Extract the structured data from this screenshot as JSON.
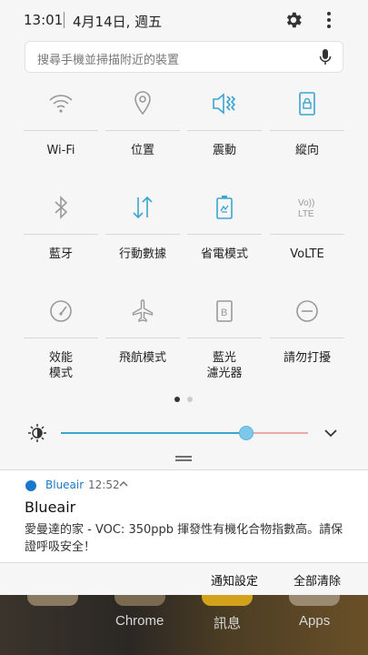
{
  "status_bar": {
    "time": "13:01",
    "date": "4月14日, 週五"
  },
  "search": {
    "placeholder": "搜尋手機並掃描附近的裝置"
  },
  "accent": "#3aa5cf",
  "tiles": [
    {
      "label": "Wi-Fi",
      "icon": "wifi-icon",
      "active": false
    },
    {
      "label": "位置",
      "icon": "location-icon",
      "active": false
    },
    {
      "label": "震動",
      "icon": "vibrate-icon",
      "active": true
    },
    {
      "label": "縱向",
      "icon": "portrait-lock-icon",
      "active": true
    },
    {
      "label": "藍牙",
      "icon": "bluetooth-icon",
      "active": false
    },
    {
      "label": "行動數據",
      "icon": "mobile-data-icon",
      "active": true
    },
    {
      "label": "省電模式",
      "icon": "power-saving-icon",
      "active": true
    },
    {
      "label": "VoLTE",
      "icon": "volte-icon",
      "active": false
    },
    {
      "label": "效能\n模式",
      "icon": "performance-icon",
      "active": false
    },
    {
      "label": "飛航模式",
      "icon": "airplane-icon",
      "active": false
    },
    {
      "label": "藍光\n濾光器",
      "icon": "blue-light-filter-icon",
      "active": false
    },
    {
      "label": "請勿打擾",
      "icon": "do-not-disturb-icon",
      "active": false
    }
  ],
  "page_indicator": {
    "current": 1,
    "total": 2
  },
  "brightness": {
    "level": 0.75
  },
  "notification": {
    "app": "Blueair",
    "time": "12:52",
    "title": "Blueair",
    "body": "愛曼達的家 - VOC: 350ppb 揮發性有機化合物指數高。請保證呼吸安全！"
  },
  "actions": {
    "settings": "通知設定",
    "clear_all": "全部清除"
  },
  "home_apps": [
    "Chrome",
    "訊息",
    "Apps"
  ]
}
